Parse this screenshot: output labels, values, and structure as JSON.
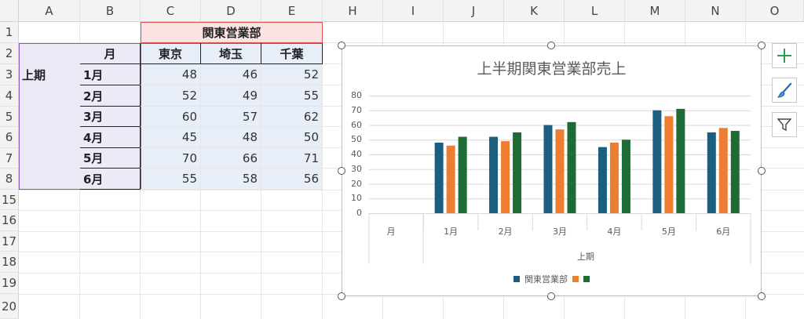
{
  "columns": [
    "A",
    "B",
    "C",
    "D",
    "E",
    "H",
    "I",
    "J",
    "K",
    "L",
    "M",
    "N",
    "O"
  ],
  "rows": [
    "1",
    "2",
    "3",
    "4",
    "5",
    "6",
    "7",
    "8",
    "15",
    "16",
    "17",
    "18",
    "19",
    "20"
  ],
  "table": {
    "header_group": "関東営業部",
    "col_month": "月",
    "regions": [
      "東京",
      "埼玉",
      "千葉"
    ],
    "period": "上期",
    "months": [
      "1月",
      "2月",
      "3月",
      "4月",
      "5月",
      "6月"
    ],
    "values": [
      [
        48,
        46,
        52
      ],
      [
        52,
        49,
        55
      ],
      [
        60,
        57,
        62
      ],
      [
        45,
        48,
        50
      ],
      [
        70,
        66,
        71
      ],
      [
        55,
        58,
        56
      ]
    ]
  },
  "chart": {
    "title": "上半期関東営業部売上",
    "y_ticks": [
      "80",
      "70",
      "60",
      "50",
      "40",
      "30",
      "20",
      "10",
      "0"
    ],
    "x_first_label": "月",
    "x_group_label": "上期",
    "legend_labels": [
      "関東営業部",
      "",
      ""
    ],
    "colors": [
      "#1b5e80",
      "#ed7d31",
      "#1e6b35"
    ]
  },
  "chart_data": {
    "type": "bar",
    "title": "上半期関東営業部売上",
    "categories": [
      "月",
      "1月",
      "2月",
      "3月",
      "4月",
      "5月",
      "6月"
    ],
    "series": [
      {
        "name": "関東営業部",
        "values": [
          null,
          48,
          52,
          60,
          45,
          70,
          55
        ]
      },
      {
        "values": [
          null,
          46,
          49,
          57,
          48,
          66,
          58
        ]
      },
      {
        "values": [
          null,
          52,
          55,
          62,
          50,
          71,
          56
        ]
      }
    ],
    "ylim": [
      0,
      80
    ],
    "grid": true,
    "legend": "bottom"
  }
}
